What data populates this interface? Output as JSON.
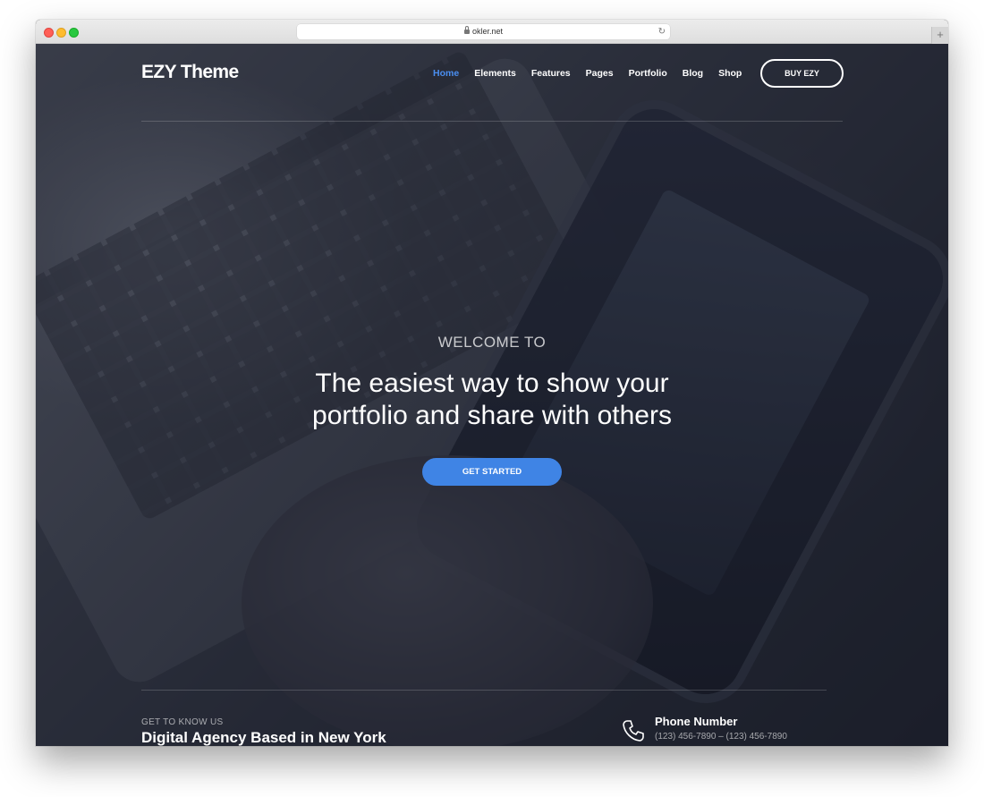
{
  "browser": {
    "url": "okler.net",
    "new_tab": "+"
  },
  "nav": {
    "logo": "EZY Theme",
    "items": [
      {
        "label": "Home",
        "active": true
      },
      {
        "label": "Elements"
      },
      {
        "label": "Features"
      },
      {
        "label": "Pages"
      },
      {
        "label": "Portfolio"
      },
      {
        "label": "Blog"
      },
      {
        "label": "Shop"
      }
    ],
    "buy_button": "BUY EZY"
  },
  "hero": {
    "kicker": "WELCOME TO",
    "headline_line1": "The easiest way to show your",
    "headline_line2": "portfolio and share with others",
    "cta": "GET STARTED"
  },
  "footer": {
    "kicker": "GET TO KNOW US",
    "title": "Digital Agency Based in New York",
    "phone_label": "Phone Number",
    "phone_numbers": "(123) 456-7890 – (123) 456-7890"
  },
  "colors": {
    "accent": "#3f84e5",
    "active_nav": "#4a8ef0"
  },
  "icons": [
    "lock-icon",
    "reload-icon",
    "phone-icon"
  ]
}
